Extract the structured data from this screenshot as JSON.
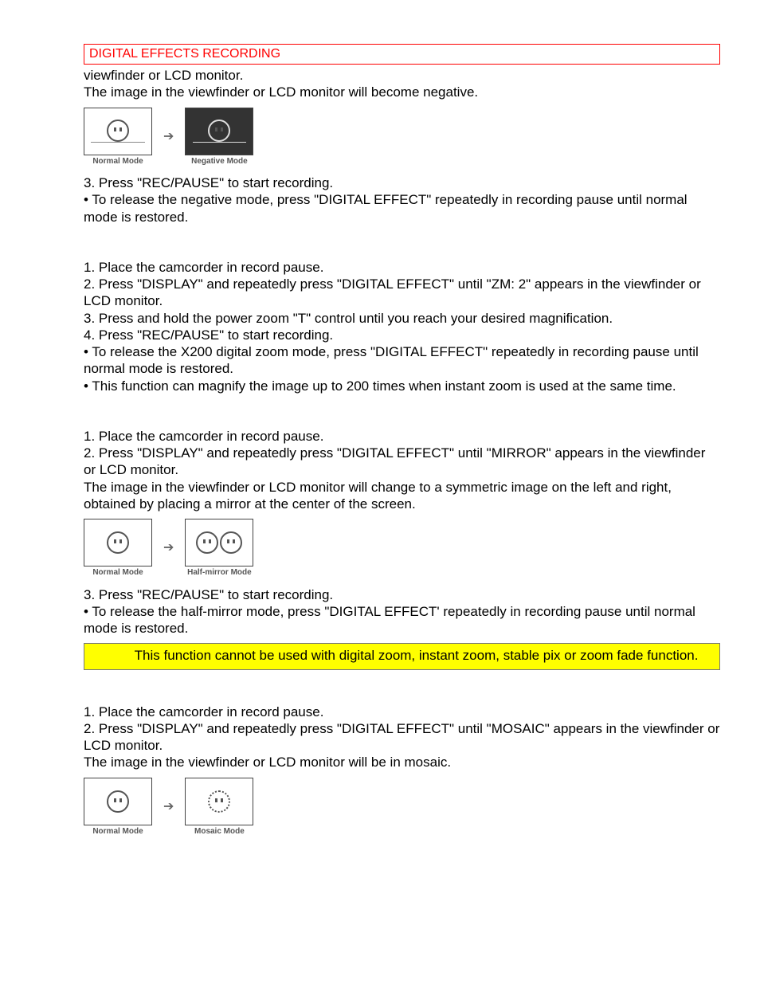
{
  "header": {
    "title": "DIGITAL EFFECTS RECORDING"
  },
  "negative": {
    "intro1": "viewfinder or LCD monitor.",
    "intro2": "The image in the viewfinder or LCD monitor will become negative.",
    "fig_left": "Normal Mode",
    "fig_right": "Negative Mode",
    "step3": "3. Press \"REC/PAUSE\" to start recording.",
    "release": "• To release the negative mode, press \"DIGITAL EFFECT\" repeatedly in recording pause until normal mode is restored."
  },
  "zoom": {
    "step1": "1. Place the camcorder in record pause.",
    "step2": "2. Press \"DISPLAY\" and repeatedly press \"DIGITAL EFFECT\" until \"ZM: 2\" appears in the viewfinder or LCD monitor.",
    "step3": "3. Press and hold the power zoom \"T\" control until you reach your desired magnification.",
    "step4": "4. Press \"REC/PAUSE\" to start recording.",
    "release": "• To release the X200 digital zoom mode, press \"DIGITAL EFFECT\" repeatedly in recording pause until normal mode is restored.",
    "note": "• This function can magnify the image up to 200 times when instant zoom is used at the same time."
  },
  "mirror": {
    "step1": "1. Place the camcorder in record pause.",
    "step2": "2. Press \"DISPLAY\" and repeatedly press \"DIGITAL EFFECT\" until \"MIRROR\" appears in the viewfinder or LCD monitor.",
    "desc": "The image in the viewfinder or LCD monitor will change to a symmetric image on the left and right, obtained by placing a mirror at the center of the screen.",
    "fig_left": "Normal Mode",
    "fig_right": "Half-mirror Mode",
    "step3": "3. Press \"REC/PAUSE\" to start recording.",
    "release": "• To release the half-mirror mode, press \"DIGITAL EFFECT' repeatedly in recording pause until normal mode is restored.",
    "warning": "            This function cannot be used with digital zoom, instant zoom, stable pix or zoom fade function."
  },
  "mosaic": {
    "step1": "1. Place the camcorder in record pause.",
    "step2": "2. Press \"DISPLAY\" and repeatedly press \"DIGITAL EFFECT\" until \"MOSAIC\"  appears in the viewfinder or LCD monitor.",
    "desc": "The image in the viewfinder or LCD monitor will be in mosaic.",
    "fig_left": "Normal Mode",
    "fig_right": "Mosaic Mode"
  }
}
